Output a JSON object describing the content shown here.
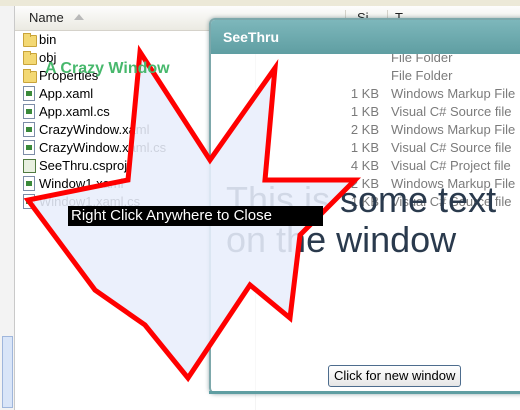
{
  "explorer": {
    "columns": {
      "name": "Name",
      "size": "Si",
      "type": "T"
    },
    "files": [
      {
        "name": "bin",
        "size": "",
        "type": "",
        "icon": "folder-icon"
      },
      {
        "name": "obj",
        "size": "",
        "type": "File Folder",
        "icon": "folder-icon"
      },
      {
        "name": "Properties",
        "size": "",
        "type": "File Folder",
        "icon": "folder-icon"
      },
      {
        "name": "App.xaml",
        "size": "1 KB",
        "type": "Windows Markup File",
        "icon": "xaml-file-icon"
      },
      {
        "name": "App.xaml.cs",
        "size": "1 KB",
        "type": "Visual C# Source file",
        "icon": "cs-file-icon"
      },
      {
        "name": "CrazyWindow.xaml",
        "size": "2 KB",
        "type": "Windows Markup File",
        "icon": "xaml-file-icon"
      },
      {
        "name": "CrazyWindow.xaml.cs",
        "size": "1 KB",
        "type": "Visual C# Source file",
        "icon": "cs-file-icon"
      },
      {
        "name": "SeeThru.csproj",
        "size": "4 KB",
        "type": "Visual C# Project file",
        "icon": "csproj-file-icon"
      },
      {
        "name": "Window1.xaml",
        "size": "2 KB",
        "type": "Windows Markup File",
        "icon": "xaml-file-icon"
      },
      {
        "name": "Window1.xaml.cs",
        "size": "1 KB",
        "type": "Visual C# Source file",
        "icon": "cs-file-icon"
      }
    ]
  },
  "seethru": {
    "title": "SeeThru",
    "body_text": "This is some text on the window",
    "button_label": "Click for new window",
    "accent_color": "#5f9ea2"
  },
  "crazy_window": {
    "title": "A Crazy Window",
    "hint": "Right Click Anywhere to Close",
    "border_color": "#ff0000",
    "fill_color": "#e8eefc"
  }
}
